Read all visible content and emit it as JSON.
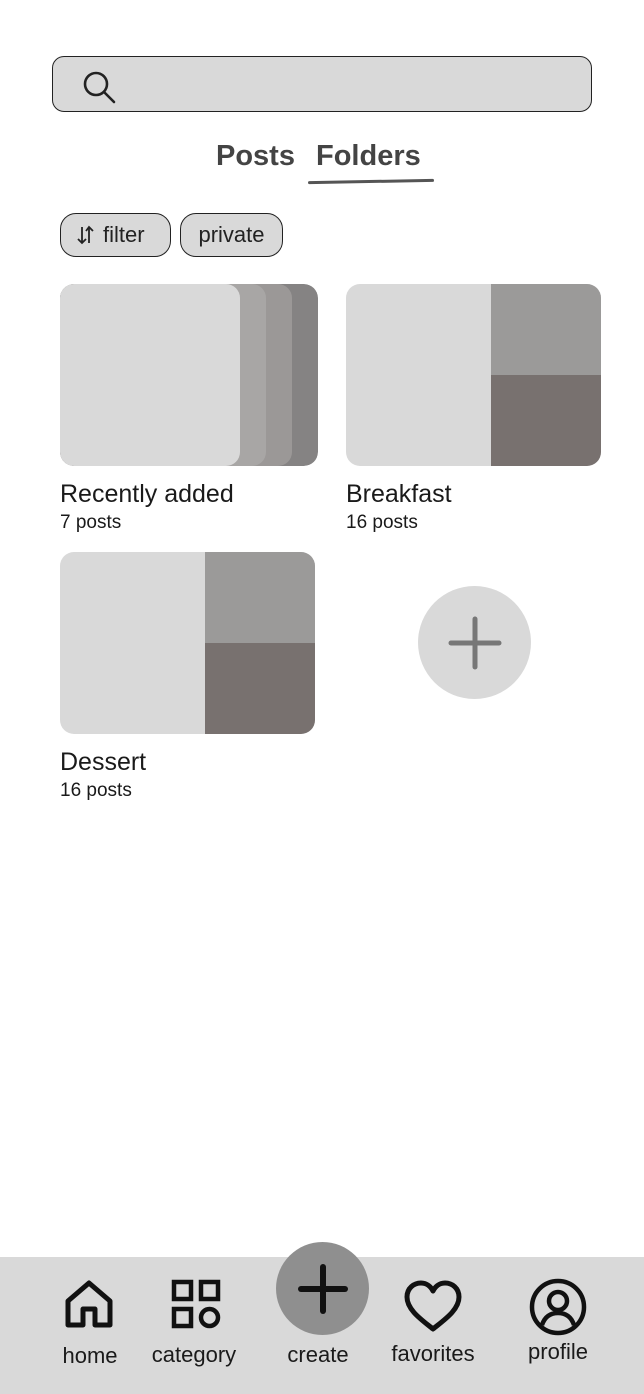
{
  "search": {
    "placeholder": "",
    "value": ""
  },
  "tabs": [
    {
      "label": "Posts",
      "active": false
    },
    {
      "label": "Folders",
      "active": true
    }
  ],
  "chips": {
    "filter_label": "filter",
    "private_label": "private"
  },
  "folders": [
    {
      "name": "Recently added",
      "count": "7 posts"
    },
    {
      "name": "Breakfast",
      "count": "16 posts"
    },
    {
      "name": "Dessert",
      "count": "16 posts"
    }
  ],
  "nav": {
    "home": "home",
    "category": "category",
    "create": "create",
    "favorites": "favorites",
    "profile": "profile"
  },
  "colors": {
    "thumb_light": "#d9d9d9",
    "thumb_mid": "#9b9a99",
    "thumb_dark": "#78716f",
    "nav_bg": "#d9d9d9",
    "create_bg": "#8f8f8f"
  }
}
